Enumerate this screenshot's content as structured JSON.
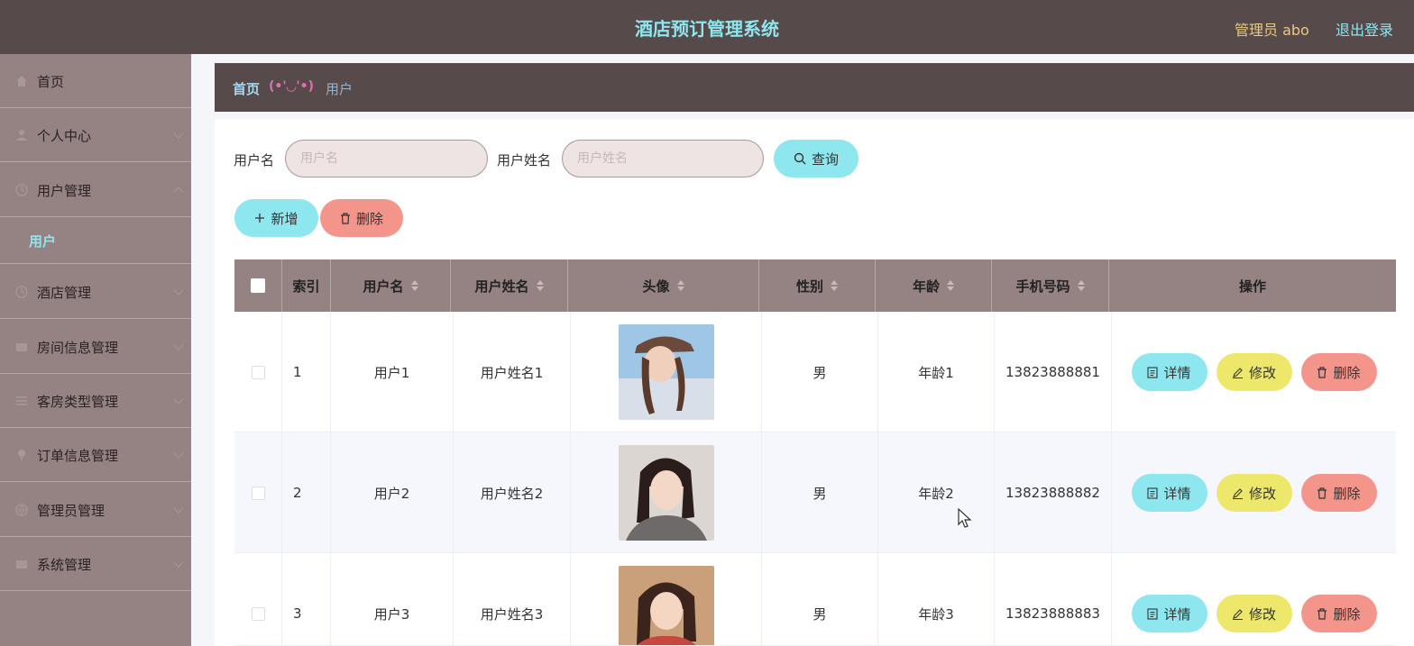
{
  "header": {
    "title": "酒店预订管理系统",
    "admin": "管理员 abo",
    "logout": "退出登录"
  },
  "sidebar": {
    "items": [
      {
        "label": "首页",
        "icon": "home-icon"
      },
      {
        "label": "个人中心",
        "icon": "user-icon"
      },
      {
        "label": "用户管理",
        "icon": "clock-icon"
      },
      {
        "label": "酒店管理",
        "icon": "clock-icon"
      },
      {
        "label": "房间信息管理",
        "icon": "card-icon"
      },
      {
        "label": "客房类型管理",
        "icon": "list-icon"
      },
      {
        "label": "订单信息管理",
        "icon": "pin-icon"
      },
      {
        "label": "管理员管理",
        "icon": "globe-icon"
      },
      {
        "label": "系统管理",
        "icon": "card-icon"
      }
    ],
    "sub_item": "用户"
  },
  "breadcrumb": {
    "home": "首页",
    "separator": "(•'◡'•)",
    "current": "用户"
  },
  "search": {
    "username_label": "用户名",
    "username_placeholder": "用户名",
    "name_label": "用户姓名",
    "name_placeholder": "用户姓名",
    "query_button": "查询"
  },
  "actions": {
    "add": "新增",
    "delete": "删除"
  },
  "table": {
    "columns": [
      "索引",
      "用户名",
      "用户姓名",
      "头像",
      "性别",
      "年龄",
      "手机号码",
      "操作"
    ],
    "rows": [
      {
        "index": "1",
        "username": "用户1",
        "name": "用户姓名1",
        "gender": "男",
        "age": "年龄1",
        "phone": "13823888881"
      },
      {
        "index": "2",
        "username": "用户2",
        "name": "用户姓名2",
        "gender": "男",
        "age": "年龄2",
        "phone": "13823888882"
      },
      {
        "index": "3",
        "username": "用户3",
        "name": "用户姓名3",
        "gender": "男",
        "age": "年龄3",
        "phone": "13823888883"
      }
    ],
    "row_buttons": {
      "detail": "详情",
      "edit": "修改",
      "delete": "删除"
    }
  },
  "colors": {
    "header_bg": "#574a4a",
    "sidebar_bg": "#958282",
    "accent_cyan": "#8ee6ee",
    "accent_red": "#f3958a",
    "accent_yellow": "#ede86c"
  }
}
